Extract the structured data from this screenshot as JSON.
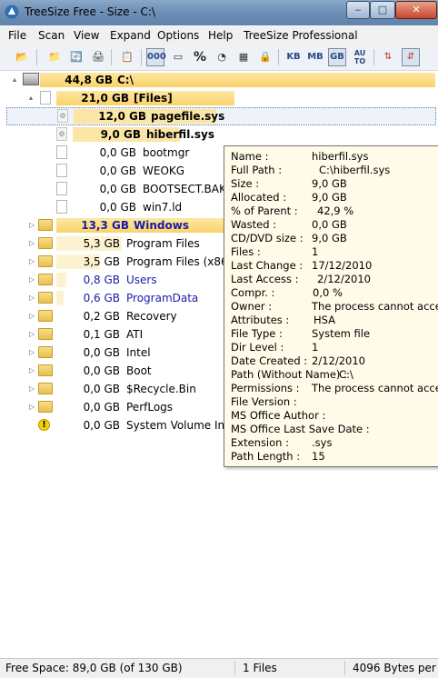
{
  "window": {
    "title": "TreeSize Free - Size - C:\\",
    "min_label": "‒",
    "max_label": "□",
    "close_label": "✕"
  },
  "menu": [
    "File",
    "Scan",
    "View",
    "Expand",
    "Options",
    "Help",
    "TreeSize Professional"
  ],
  "toolbar": {
    "kb": "KB",
    "mb": "MB",
    "gb": "GB",
    "auto_top": "AU",
    "auto_bottom": "TO",
    "percent": "%",
    "count": "000"
  },
  "tree": [
    {
      "size": "44,8 GB",
      "name": "C:\\",
      "bold": true,
      "icon": "drive-icon",
      "exp": "▴"
    },
    {
      "size": "21,0 GB",
      "name": "[Files]",
      "bold": true,
      "icon": "file-icon",
      "exp": "▴"
    },
    {
      "size": "12,0 GB",
      "name": "pagefile.sys",
      "bold": true,
      "icon": "system-file-icon",
      "exp": ""
    },
    {
      "size": "9,0 GB",
      "name": "hiberfil.sys",
      "bold": true,
      "icon": "system-file-icon",
      "exp": ""
    },
    {
      "size": "0,0 GB",
      "name": "bootmgr",
      "bold": false,
      "icon": "file-icon",
      "exp": ""
    },
    {
      "size": "0,0 GB",
      "name": "WEOKG",
      "bold": false,
      "icon": "file-icon",
      "exp": ""
    },
    {
      "size": "0,0 GB",
      "name": "BOOTSECT.BAK",
      "bold": false,
      "icon": "file-icon",
      "exp": ""
    },
    {
      "size": "0,0 GB",
      "name": "win7.ld",
      "bold": false,
      "icon": "file-icon",
      "exp": ""
    },
    {
      "size": "13,3 GB",
      "name": "Windows",
      "bold": true,
      "icon": "folder-icon",
      "exp": "▷",
      "blue": true
    },
    {
      "size": "5,3 GB",
      "name": "Program Files",
      "bold": false,
      "icon": "folder-icon",
      "exp": "▷"
    },
    {
      "size": "3,5 GB",
      "name": "Program Files (x86)",
      "bold": false,
      "icon": "folder-icon",
      "exp": "▷"
    },
    {
      "size": "0,8 GB",
      "name": "Users",
      "bold": false,
      "icon": "folder-icon",
      "exp": "▷",
      "blue": true
    },
    {
      "size": "0,6 GB",
      "name": "ProgramData",
      "bold": false,
      "icon": "folder-icon",
      "exp": "▷",
      "blue": true
    },
    {
      "size": "0,2 GB",
      "name": "Recovery",
      "bold": false,
      "icon": "folder-icon",
      "exp": "▷"
    },
    {
      "size": "0,1 GB",
      "name": "ATI",
      "bold": false,
      "icon": "folder-icon",
      "exp": "▷"
    },
    {
      "size": "0,0 GB",
      "name": "Intel",
      "bold": false,
      "icon": "folder-icon",
      "exp": "▷"
    },
    {
      "size": "0,0 GB",
      "name": "Boot",
      "bold": false,
      "icon": "folder-icon",
      "exp": "▷"
    },
    {
      "size": "0,0 GB",
      "name": "$Recycle.Bin",
      "bold": false,
      "icon": "folder-icon",
      "exp": "▷"
    },
    {
      "size": "0,0 GB",
      "name": "PerfLogs",
      "bold": false,
      "icon": "folder-icon",
      "exp": "▷"
    },
    {
      "size": "0,0 GB",
      "name": "System Volume Info",
      "bold": false,
      "icon": "warning-icon",
      "exp": ""
    }
  ],
  "tooltip": [
    {
      "label": "Name :",
      "value": "hiberfil.sys"
    },
    {
      "label": "Full Path :",
      "value": "C:\\hiberfil.sys"
    },
    {
      "label": "Size :",
      "value": "9,0 GB"
    },
    {
      "label": "Allocated :",
      "value": "9,0 GB"
    },
    {
      "label": "% of Parent :",
      "value": "42,9 %"
    },
    {
      "label": "Wasted :",
      "value": "0,0 GB"
    },
    {
      "label": "CD/DVD size :",
      "value": "9,0 GB"
    },
    {
      "label": "Files :",
      "value": "1"
    },
    {
      "label": "Last Change :",
      "value": "17/12/2010"
    },
    {
      "label": "Last Access :",
      "value": "2/12/2010"
    },
    {
      "label": "Compr. :",
      "value": "0,0 %"
    },
    {
      "label": "Owner :",
      "value": "The process cannot access"
    },
    {
      "label": "Attributes :",
      "value": "HSA"
    },
    {
      "label": "File Type :",
      "value": "System file"
    },
    {
      "label": "Dir Level :",
      "value": "1"
    },
    {
      "label": "Date Created :",
      "value": "2/12/2010"
    },
    {
      "label": "Path (Without Name) :",
      "value": "C:\\"
    },
    {
      "label": "Permissions :",
      "value": "The process cannot access"
    },
    {
      "label": "File Version :",
      "value": ""
    },
    {
      "label": "MS Office Author :",
      "value": ""
    },
    {
      "label": "MS Office Last Save Date :",
      "value": ""
    },
    {
      "label": "Extension :",
      "value": ".sys"
    },
    {
      "label": "Path Length :",
      "value": "15"
    }
  ],
  "status": {
    "free_space": "Free Space: 89,0 GB  (of 130 GB)",
    "files": "1  Files",
    "cluster": "4096 Bytes per"
  }
}
